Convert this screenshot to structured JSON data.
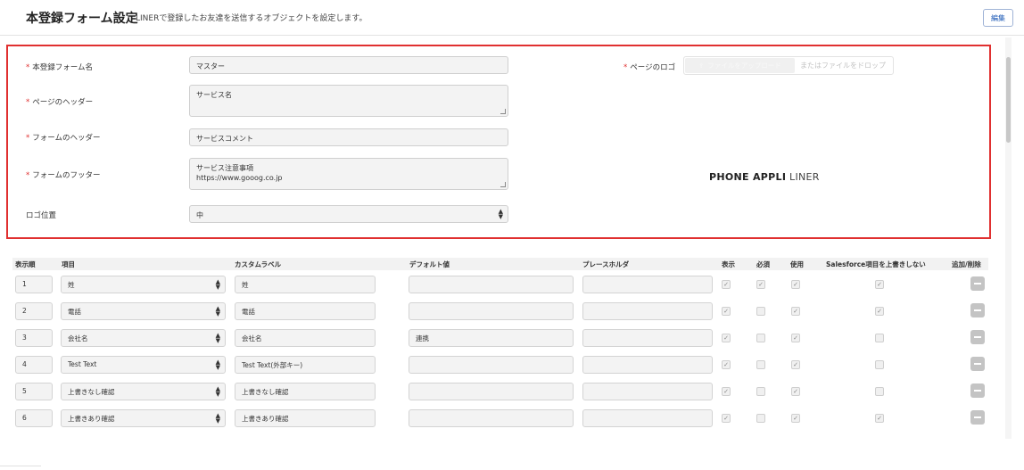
{
  "header": {
    "title": "本登録フォーム設定",
    "description": "LINERで登録したお友達を送信するオブジェクトを設定します。",
    "edit_label": "編集"
  },
  "form": {
    "required_mark": "*",
    "name": {
      "label": "本登録フォーム名",
      "value": "マスター"
    },
    "page_header": {
      "label": "ページのヘッダー",
      "value": "サービス名"
    },
    "form_header": {
      "label": "フォームのヘッダー",
      "value": "サービスコメント"
    },
    "form_footer": {
      "label": "フォームのフッター",
      "lines": [
        "サービス注意事項",
        "https://www.gooog.co.jp"
      ]
    },
    "logo_position": {
      "label": "ロゴ位置",
      "value": "中"
    },
    "page_logo": {
      "label": "ページのロゴ",
      "upload_label": "ファイルをアップロード",
      "drop_label": "またはファイルをドロップ"
    },
    "logo_preview": {
      "bold": "PHONE APPLI",
      "light": "LINER"
    }
  },
  "table": {
    "headers": {
      "order": "表示順",
      "item": "項目",
      "custom_label": "カスタムラベル",
      "default_value": "デフォルト値",
      "placeholder": "プレースホルダ",
      "display": "表示",
      "required": "必須",
      "use": "使用",
      "no_overwrite": "Salesforce項目を上書きしない",
      "add_delete": "追加/削除"
    },
    "rows": [
      {
        "order": "1",
        "item": "姓",
        "custom_label": "姓",
        "default_value": "",
        "placeholder": "",
        "display": true,
        "required": true,
        "use": true,
        "no_overwrite": true
      },
      {
        "order": "2",
        "item": "電話",
        "custom_label": "電話",
        "default_value": "",
        "placeholder": "",
        "display": true,
        "required": false,
        "use": true,
        "no_overwrite": true
      },
      {
        "order": "3",
        "item": "会社名",
        "custom_label": "会社名",
        "default_value": "連携",
        "placeholder": "",
        "display": true,
        "required": false,
        "use": true,
        "no_overwrite": false
      },
      {
        "order": "4",
        "item": "Test Text",
        "custom_label": "Test Text(外部キー)",
        "default_value": "",
        "placeholder": "",
        "display": true,
        "required": false,
        "use": true,
        "no_overwrite": false
      },
      {
        "order": "5",
        "item": "上書きなし確認",
        "custom_label": "上書きなし確認",
        "default_value": "",
        "placeholder": "",
        "display": true,
        "required": false,
        "use": true,
        "no_overwrite": false
      },
      {
        "order": "6",
        "item": "上書きあり確認",
        "custom_label": "上書きあり確認",
        "default_value": "",
        "placeholder": "",
        "display": true,
        "required": false,
        "use": true,
        "no_overwrite": true
      }
    ]
  }
}
